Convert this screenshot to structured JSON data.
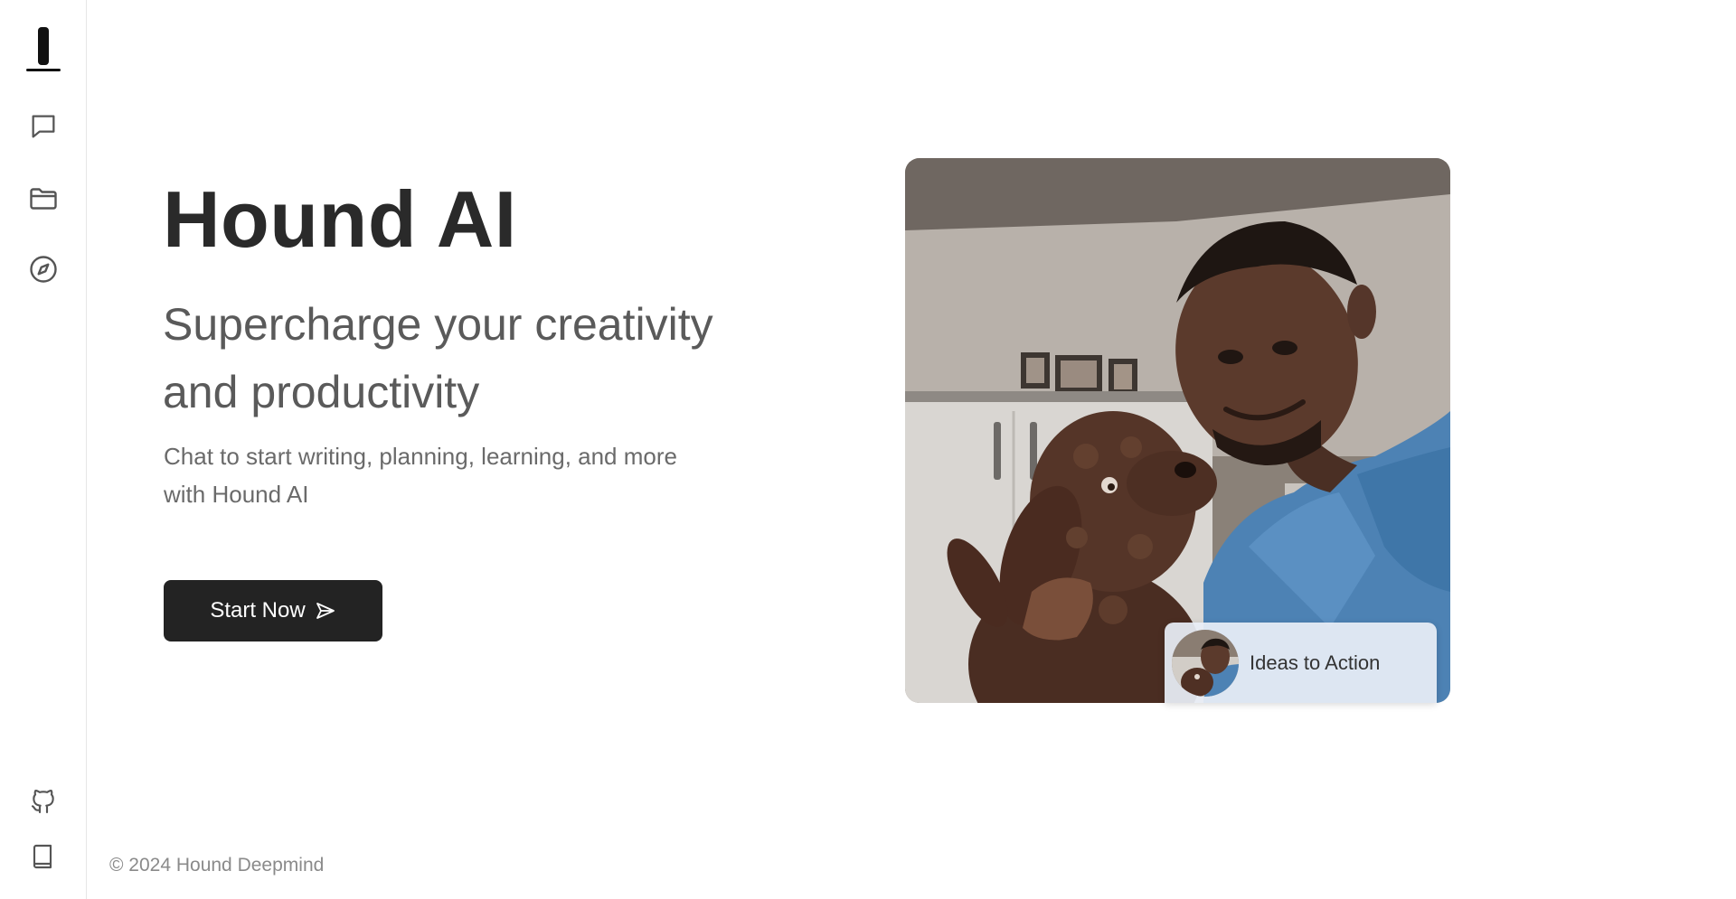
{
  "app": {
    "title": "Hound AI"
  },
  "sidebar": {
    "items": [
      {
        "name": "logo",
        "icon": "hound-logo-icon"
      },
      {
        "name": "chat",
        "icon": "chat-bubble-icon"
      },
      {
        "name": "files",
        "icon": "folder-icon"
      },
      {
        "name": "explore",
        "icon": "compass-icon"
      },
      {
        "name": "github",
        "icon": "github-icon"
      },
      {
        "name": "docs",
        "icon": "book-icon"
      }
    ]
  },
  "hero": {
    "title": "Hound AI",
    "subtitle": "Supercharge your creativity and productivity",
    "description": "Chat to start writing, planning, learning, and more with Hound AI",
    "cta_label": "Start Now",
    "cta_icon": "send-icon"
  },
  "media": {
    "caption": "Ideas to Action"
  },
  "footer": {
    "copyright": "© 2024 Hound Deepmind"
  },
  "colors": {
    "accent_button": "#232323",
    "title_text": "#2a2a2a",
    "subtitle_text": "#5a5a5a",
    "body_text": "#6a6a6a",
    "muted_text": "#8a8a8a"
  }
}
